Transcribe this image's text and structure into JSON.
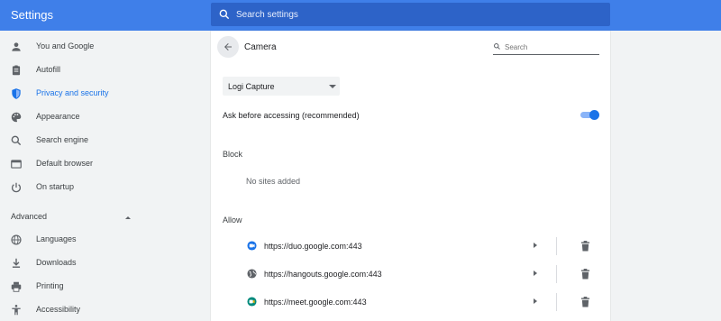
{
  "header": {
    "title": "Settings",
    "search_placeholder": "Search settings"
  },
  "sidebar": {
    "items": [
      {
        "label": "You and Google",
        "icon": "person-icon"
      },
      {
        "label": "Autofill",
        "icon": "clipboard-icon"
      },
      {
        "label": "Privacy and security",
        "icon": "shield-icon",
        "active": true
      },
      {
        "label": "Appearance",
        "icon": "palette-icon"
      },
      {
        "label": "Search engine",
        "icon": "search-icon"
      },
      {
        "label": "Default browser",
        "icon": "browser-icon"
      },
      {
        "label": "On startup",
        "icon": "power-icon"
      }
    ],
    "advanced_label": "Advanced",
    "advanced_items": [
      {
        "label": "Languages",
        "icon": "globe-icon"
      },
      {
        "label": "Downloads",
        "icon": "download-icon"
      },
      {
        "label": "Printing",
        "icon": "printer-icon"
      },
      {
        "label": "Accessibility",
        "icon": "accessibility-icon"
      }
    ]
  },
  "panel": {
    "title": "Camera",
    "search_placeholder": "Search",
    "device_select": "Logi Capture",
    "ask_label": "Ask before accessing (recommended)",
    "ask_enabled": true,
    "block_label": "Block",
    "block_empty": "No sites added",
    "allow_label": "Allow",
    "allow_sites": [
      {
        "url": "https://duo.google.com:443",
        "icon": "duo-favicon-icon"
      },
      {
        "url": "https://hangouts.google.com:443",
        "icon": "globe-favicon-icon"
      },
      {
        "url": "https://meet.google.com:443",
        "icon": "meet-favicon-icon"
      }
    ]
  },
  "colors": {
    "header_bg": "#3f7fe9",
    "accent": "#1a73e8"
  }
}
